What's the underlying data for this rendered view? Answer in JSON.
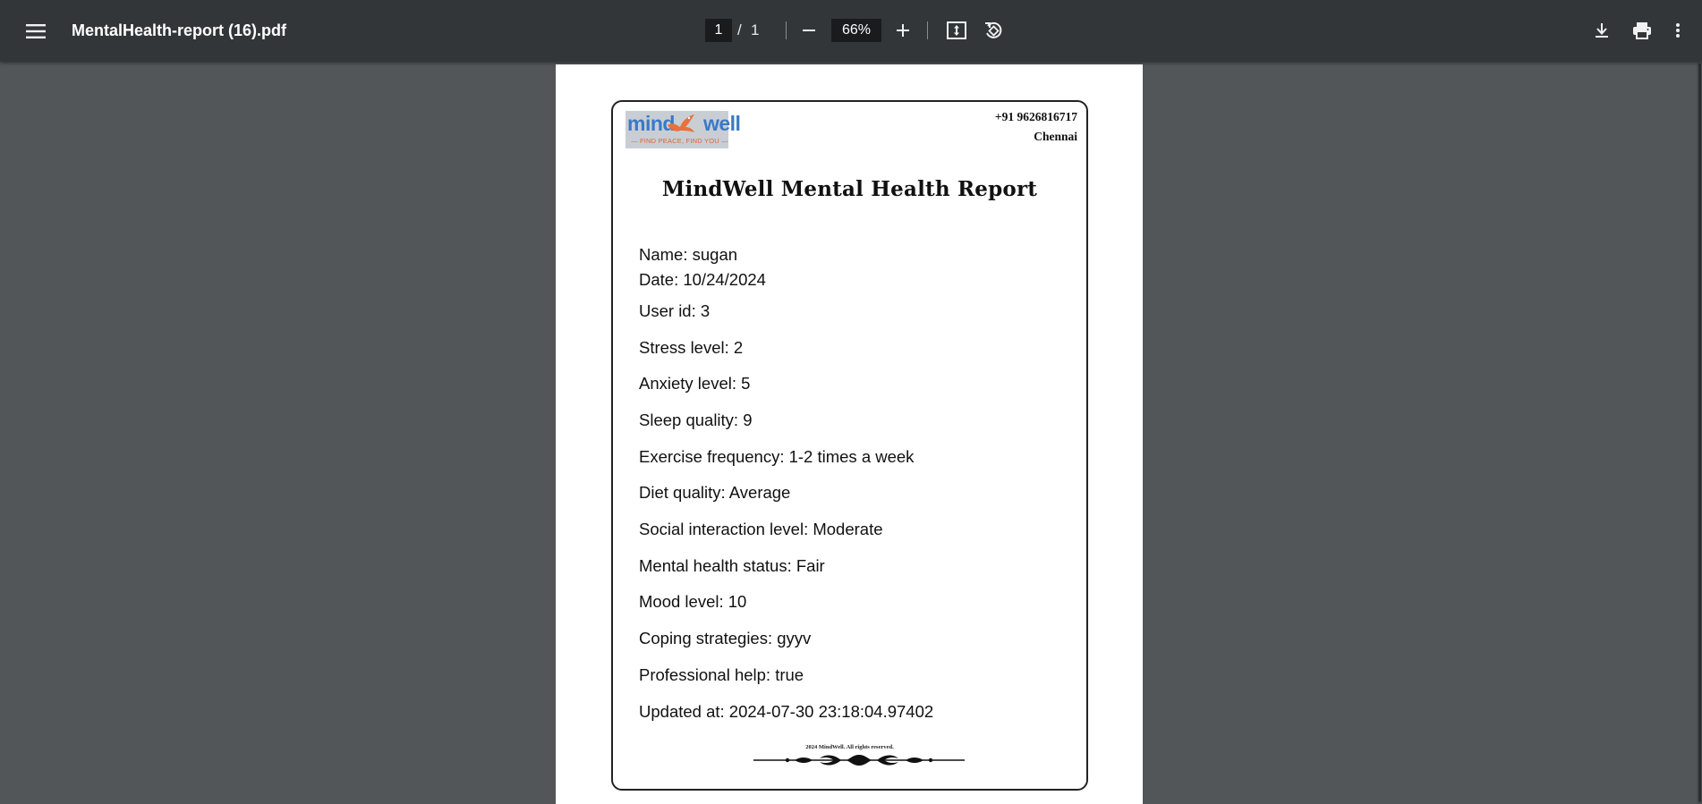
{
  "toolbar": {
    "title": "MentalHealth-report (16).pdf",
    "current_page": "1",
    "page_separator": "/",
    "total_pages": "1",
    "zoom": "66%"
  },
  "icons": [
    "menu-icon",
    "zoom-out-icon",
    "zoom-in-icon",
    "fit-page-icon",
    "rotate-icon",
    "download-icon",
    "print-icon",
    "more-options-icon"
  ],
  "report": {
    "logo_text_left": "mind",
    "logo_text_right": "well",
    "logo_tagline": "— FIND PEACE, FIND YOU —",
    "phone": "+91 9626816717",
    "city": "Chennai",
    "title": "MindWell Mental Health Report",
    "fields": [
      "Name: sugan",
      "Date: 10/24/2024",
      "User id: 3",
      "Stress level: 2",
      "Anxiety level: 5",
      "Sleep quality: 9",
      "Exercise frequency: 1-2 times a week",
      "Diet quality: Average",
      "Social interaction level: Moderate",
      "Mental health status: Fair",
      "Mood level: 10",
      "Coping strategies: gyyv",
      "Professional help: true",
      "Updated at: 2024-07-30 23:18:04.97402"
    ],
    "footer": "2024 MindWell. All rights reserved."
  }
}
